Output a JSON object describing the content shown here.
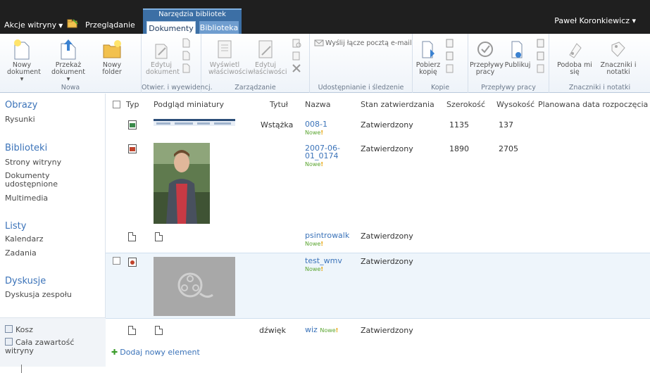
{
  "topbar": {
    "site_actions": "Akcje witryny",
    "browse_tab": "Przeglądanie",
    "contextual_group": "Narzędzia bibliotek",
    "tabs": [
      {
        "label": "Dokumenty",
        "active": true
      },
      {
        "label": "Biblioteka",
        "active": false
      }
    ],
    "user": "Paweł Koronkiewicz ▾",
    "colors": {
      "bar": "#1f1f1f",
      "contextual": "#3c6fa5",
      "accent": "#3b73b9"
    }
  },
  "ribbon": {
    "groups": [
      {
        "label": "Nowa",
        "buttons": [
          "Nowy dokument",
          "Przekaż dokument",
          "Nowy folder"
        ]
      },
      {
        "label": "Otwier. i wyewidencj.",
        "buttons": [
          "Edytuj dokument"
        ]
      },
      {
        "label": "Zarządzanie",
        "buttons": [
          "Wyświetl właściwości",
          "Edytuj właściwości"
        ]
      },
      {
        "label": "Udostępnianie i śledzenie",
        "buttons": [
          "Wyślij łącze pocztą e-mail"
        ]
      },
      {
        "label": "Kopie",
        "buttons": [
          "Pobierz kopię"
        ]
      },
      {
        "label": "Przepływy pracy",
        "buttons": [
          "Przepływy pracy",
          "Publikuj"
        ]
      },
      {
        "label": "Znaczniki i notatki",
        "buttons": [
          "Podoba mi się",
          "Znaczniki i notatki"
        ]
      }
    ]
  },
  "quicklaunch": {
    "obrazy": {
      "heading": "Obrazy",
      "items": [
        "Rysunki"
      ]
    },
    "biblioteki": {
      "heading": "Biblioteki",
      "items": [
        "Strony witryny",
        "Dokumenty udostępnione",
        "Multimedia"
      ]
    },
    "listy": {
      "heading": "Listy",
      "items": [
        "Kalendarz",
        "Zadania"
      ]
    },
    "dyskusje": {
      "heading": "Dyskusje",
      "items": [
        "Dyskusja zespołu"
      ]
    },
    "recycle": "Kosz",
    "all_content": "Cała zawartość witryny"
  },
  "list": {
    "columns": [
      "Typ",
      "Podgląd miniatury",
      "Tytuł",
      "Nazwa",
      "Stan zatwierdzania",
      "Szerokość",
      "Wysokość",
      "Planowana data rozpoczęcia"
    ],
    "new_label": "Nowe",
    "rows": [
      {
        "type": "image",
        "title": "Wstążka",
        "name": "008-1",
        "status": "Zatwierdzony",
        "width": "1135",
        "height": "137"
      },
      {
        "type": "image",
        "title": "",
        "name": "2007-06-01_0174",
        "status": "Zatwierdzony",
        "width": "1890",
        "height": "2705"
      },
      {
        "type": "document",
        "title": "",
        "name": "psintrowalk",
        "status": "Zatwierdzony",
        "width": "",
        "height": ""
      },
      {
        "type": "video",
        "title": "",
        "name": "test_wmv",
        "status": "Zatwierdzony",
        "width": "",
        "height": ""
      },
      {
        "type": "document",
        "title": "dźwięk",
        "name": "wiz",
        "status": "Zatwierdzony",
        "width": "",
        "height": ""
      }
    ],
    "add_new": "Dodaj nowy element"
  }
}
